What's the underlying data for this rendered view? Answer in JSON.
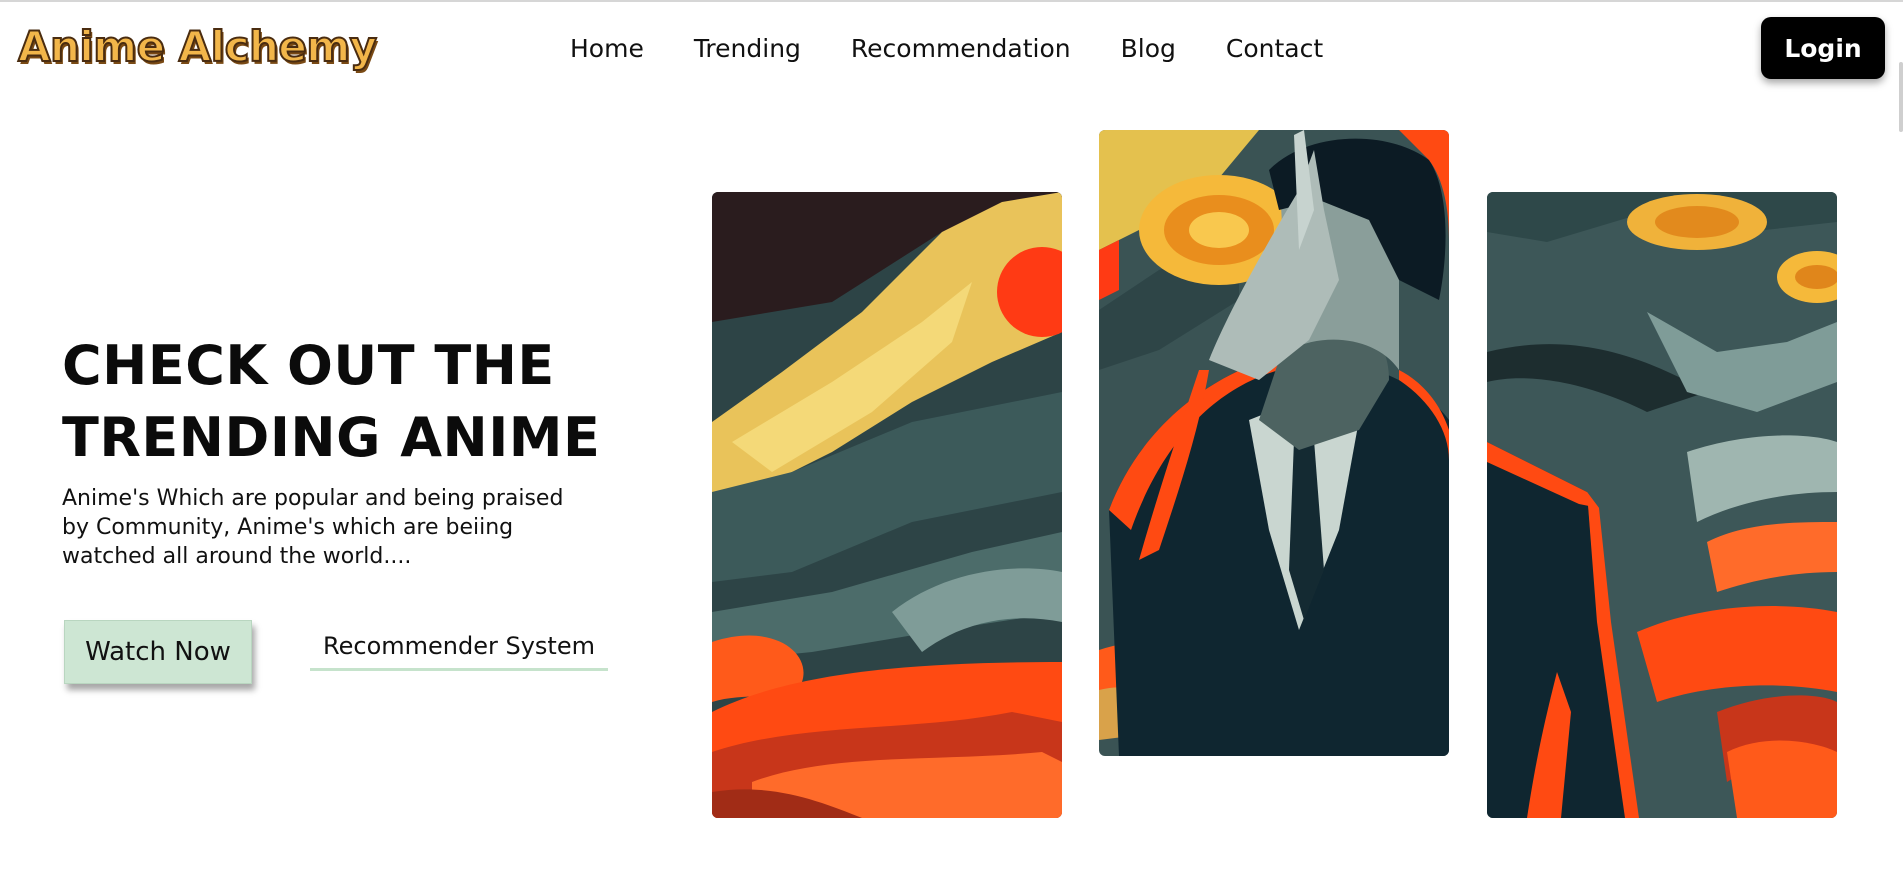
{
  "header": {
    "logo": "Anime Alchemy",
    "nav": [
      "Home",
      "Trending",
      "Recommendation",
      "Blog",
      "Contact"
    ],
    "login_label": "Login"
  },
  "hero": {
    "title_line1": "CHECK OUT THE",
    "title_line2": "TRENDING ANIME",
    "subtitle": "Anime's Which are popular and being praised by Community, Anime's which are beiing watched all around the world....",
    "watch_label": "Watch Now",
    "recommender_label": "Recommender System"
  },
  "cards": {
    "left_name": "anime-artwork-left",
    "middle_name": "anime-artwork-center",
    "right_name": "anime-artwork-right"
  },
  "colors": {
    "accent_green": "#cde6d3",
    "underline_green": "#c6e3cc",
    "login_bg": "#000000",
    "logo_fill": "#f2b64a",
    "art_orange": "#ff4a12",
    "art_teal": "#2f4a4c",
    "art_yellow": "#f5c64a"
  }
}
